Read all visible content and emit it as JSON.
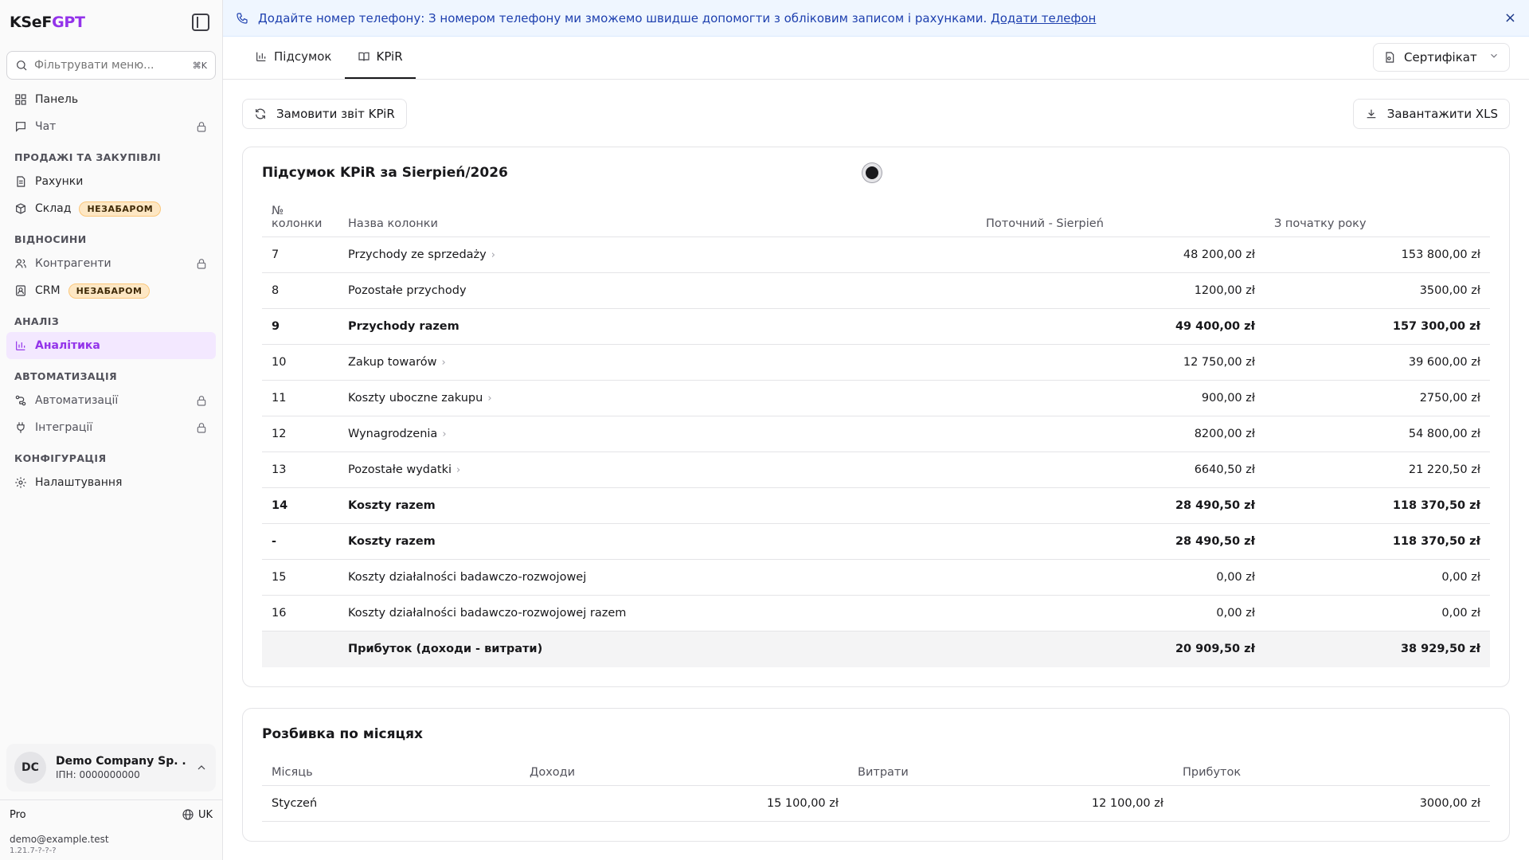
{
  "app": {
    "logo_main": "KSeF",
    "logo_accent": "GPT"
  },
  "sidebar": {
    "search_placeholder": "Фільтрувати меню...",
    "search_shortcut": "⌘K",
    "top_items": [
      {
        "label": "Панель",
        "icon": "dashboard-icon"
      },
      {
        "label": "Чат",
        "icon": "chat-icon",
        "locked": true
      }
    ],
    "sections": [
      {
        "title": "ПРОДАЖІ ТА ЗАКУПІВЛІ",
        "items": [
          {
            "label": "Рахунки",
            "icon": "invoice-icon"
          },
          {
            "label": "Склад",
            "icon": "box-icon",
            "badge": "НЕЗАБАРОМ"
          }
        ]
      },
      {
        "title": "ВІДНОСИНИ",
        "items": [
          {
            "label": "Контрагенти",
            "icon": "users-icon",
            "locked": true
          },
          {
            "label": "CRM",
            "icon": "contact-icon",
            "badge": "НЕЗАБАРОМ"
          }
        ]
      },
      {
        "title": "АНАЛІЗ",
        "items": [
          {
            "label": "Аналітика",
            "icon": "chart-icon",
            "active": true
          }
        ]
      },
      {
        "title": "АВТОМАТИЗАЦІЯ",
        "items": [
          {
            "label": "Автоматизації",
            "icon": "workflow-icon",
            "locked": true
          },
          {
            "label": "Інтеграції",
            "icon": "plug-icon",
            "locked": true
          }
        ]
      },
      {
        "title": "КОНФІГУРАЦІЯ",
        "items": [
          {
            "label": "Налаштування",
            "icon": "gear-icon"
          }
        ]
      }
    ],
    "company": {
      "initials": "DC",
      "name": "Demo Company Sp. ...",
      "nip": "ІПН: 0000000000"
    },
    "plan": "Pro",
    "language": "UK",
    "email": "demo@example.test",
    "version": "1.21.7-?-?-?"
  },
  "banner": {
    "text": "Додайте номер телефону: З номером телефону ми зможемо швидше допомогти з обліковим записом і рахунками.",
    "link": "Додати телефон",
    "close": "×"
  },
  "tabs": [
    {
      "label": "Підсумок",
      "icon": "bar-chart-icon"
    },
    {
      "label": "KPiR",
      "icon": "book-icon",
      "active": true
    }
  ],
  "certificate": {
    "label": "Сертифікат"
  },
  "actions": {
    "order_report": "Замовити звіт KPiR",
    "download_xls": "Завантажити XLS"
  },
  "summary": {
    "title": "Підсумок KPiR за Sierpień/2026",
    "headers": {
      "col_no": "№ колонки",
      "col_name": "Назва колонки",
      "current": "Поточний - Sierpień",
      "ytd": "З початку року"
    },
    "rows": [
      {
        "no": "7",
        "name": "Przychody ze sprzedaży",
        "current": "48 200,00 zł",
        "ytd": "153 800,00 zł",
        "expandable": true
      },
      {
        "no": "8",
        "name": "Pozostałe przychody",
        "current": "1200,00 zł",
        "ytd": "3500,00 zł"
      },
      {
        "no": "9",
        "name": "Przychody razem",
        "current": "49 400,00 zł",
        "ytd": "157 300,00 zł",
        "bold": true
      },
      {
        "no": "10",
        "name": "Zakup towarów",
        "current": "12 750,00 zł",
        "ytd": "39 600,00 zł",
        "expandable": true
      },
      {
        "no": "11",
        "name": "Koszty uboczne zakupu",
        "current": "900,00 zł",
        "ytd": "2750,00 zł",
        "expandable": true
      },
      {
        "no": "12",
        "name": "Wynagrodzenia",
        "current": "8200,00 zł",
        "ytd": "54 800,00 zł",
        "expandable": true
      },
      {
        "no": "13",
        "name": "Pozostałe wydatki",
        "current": "6640,50 zł",
        "ytd": "21 220,50 zł",
        "expandable": true
      },
      {
        "no": "14",
        "name": "Koszty razem",
        "current": "28 490,50 zł",
        "ytd": "118 370,50 zł",
        "bold": true
      },
      {
        "no": "-",
        "name": "Koszty razem",
        "current": "28 490,50 zł",
        "ytd": "118 370,50 zł",
        "bold": true
      },
      {
        "no": "15",
        "name": "Koszty działalności badawczo-rozwojowej",
        "current": "0,00 zł",
        "ytd": "0,00 zł"
      },
      {
        "no": "16",
        "name": "Koszty działalności badawczo-rozwojowej razem",
        "current": "0,00 zł",
        "ytd": "0,00 zł"
      }
    ],
    "total": {
      "name": "Прибуток (доходи - витрати)",
      "current": "20 909,50 zł",
      "ytd": "38 929,50 zł"
    }
  },
  "monthly": {
    "title": "Розбивка по місяцях",
    "headers": {
      "month": "Місяць",
      "income": "Доходи",
      "expenses": "Витрати",
      "profit": "Прибуток"
    },
    "rows": [
      {
        "month": "Styczeń",
        "income": "15 100,00 zł",
        "expenses": "12 100,00 zł",
        "profit": "3000,00 zł"
      }
    ]
  }
}
